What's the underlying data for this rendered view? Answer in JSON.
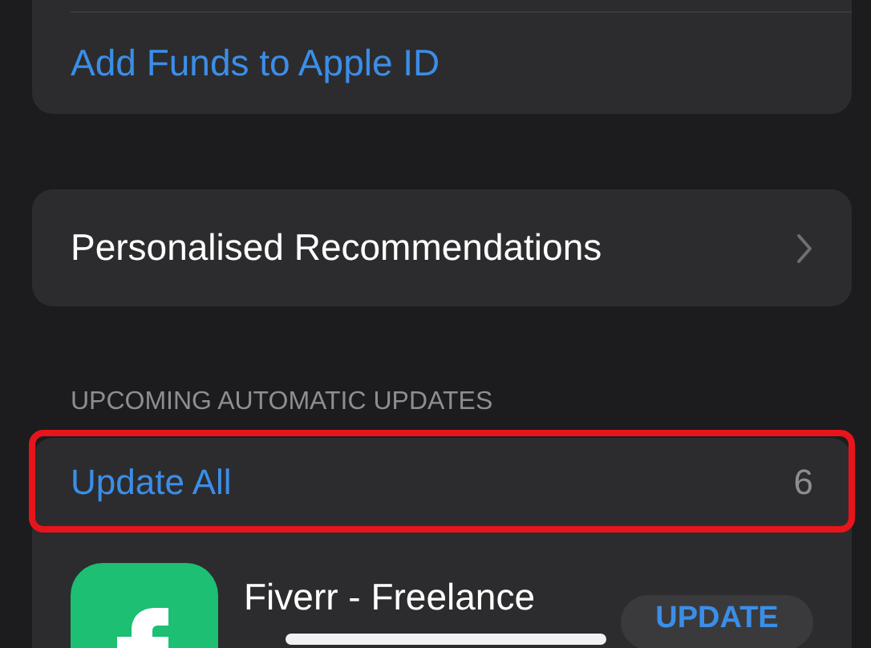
{
  "account": {
    "add_funds": "Add Funds to Apple ID"
  },
  "recommendations": {
    "label": "Personalised Recommendations"
  },
  "updates": {
    "header": "UPCOMING AUTOMATIC UPDATES",
    "update_all": "Update All",
    "count": "6",
    "highlighted": true,
    "apps": [
      {
        "name": "Fiverr - Freelance",
        "button": "UPDATE"
      }
    ]
  }
}
